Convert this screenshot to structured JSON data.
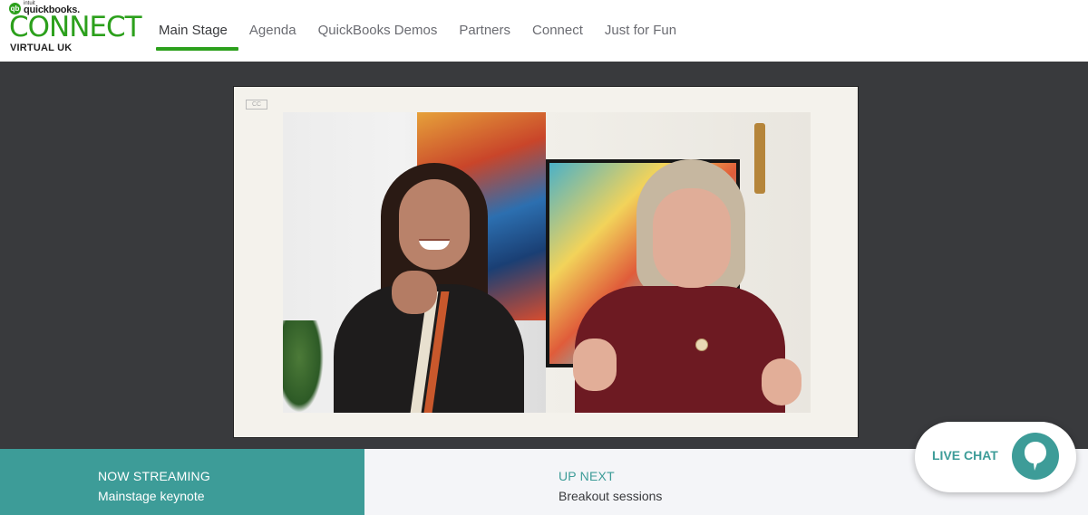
{
  "brand": {
    "intuit": "intuit",
    "quickbooks": "quickbooks.",
    "connect": "CONNECT",
    "virtual": "VIRTUAL UK",
    "accent_color": "#2ca01c"
  },
  "nav": {
    "items": [
      {
        "label": "Main Stage",
        "active": true
      },
      {
        "label": "Agenda",
        "active": false
      },
      {
        "label": "QuickBooks Demos",
        "active": false
      },
      {
        "label": "Partners",
        "active": false
      },
      {
        "label": "Connect",
        "active": false
      },
      {
        "label": "Just for Fun",
        "active": false
      }
    ]
  },
  "player": {
    "badge": "CC"
  },
  "now_streaming": {
    "label": "NOW STREAMING",
    "title": "Mainstage keynote",
    "color": "#3d9c98"
  },
  "up_next": {
    "label": "UP NEXT",
    "title": "Breakout sessions"
  },
  "live_chat": {
    "label": "LIVE CHAT",
    "icon": "chat-bubble-icon"
  }
}
